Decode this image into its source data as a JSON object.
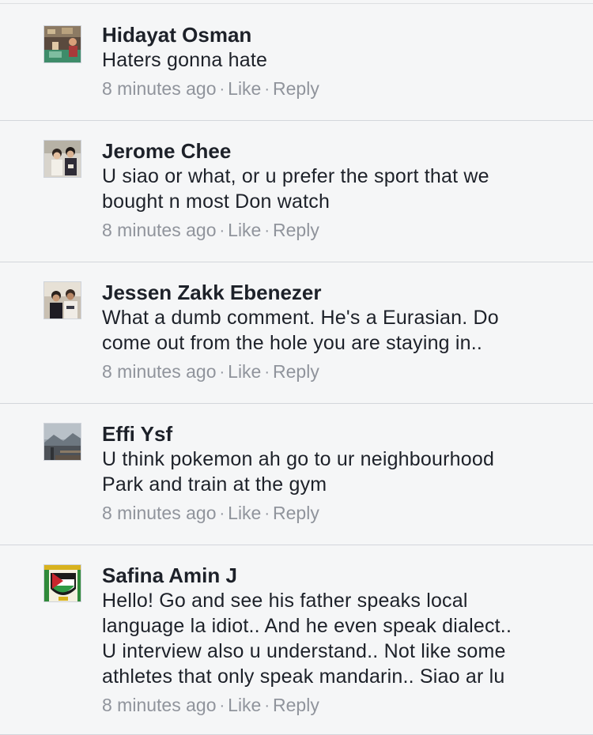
{
  "comments": [
    {
      "author": "Hidayat Osman",
      "lines": [
        "Haters gonna hate"
      ],
      "time": "8 minutes ago",
      "like": "Like",
      "reply": "Reply",
      "separator": "·",
      "avatar": "avatar-photo"
    },
    {
      "author": "Jerome Chee",
      "lines": [
        "U siao or what, or u prefer the sport that we",
        "bought n most Don watch"
      ],
      "time": "8 minutes ago",
      "like": "Like",
      "reply": "Reply",
      "separator": "·",
      "avatar": "avatar-photo"
    },
    {
      "author": "Jessen Zakk Ebenezer",
      "lines": [
        "What a dumb comment. He's a Eurasian.  Do",
        "come out from the hole you are staying in.."
      ],
      "time": "8 minutes ago",
      "like": "Like",
      "reply": "Reply",
      "separator": "·",
      "avatar": "avatar-photo"
    },
    {
      "author": "Effi Ysf",
      "lines": [
        "U think pokemon ah go to ur neighbourhood",
        "Park and train at the gym"
      ],
      "time": "8 minutes ago",
      "like": "Like",
      "reply": "Reply",
      "separator": "·",
      "avatar": "avatar-photo"
    },
    {
      "author": "Safina Amin J",
      "lines": [
        "Hello! Go and see his father speaks local",
        "language la idiot.. And he even speak dialect..",
        "U interview also u understand..  Not like some",
        "athletes that only speak mandarin.. Siao ar lu"
      ],
      "time": "8 minutes ago",
      "like": "Like",
      "reply": "Reply",
      "separator": "·",
      "avatar": "avatar-flag-emblem"
    }
  ],
  "colors": {
    "background": "#f5f6f7",
    "author": "#1d2129",
    "meta": "#90949c",
    "divider": "#d3d6db"
  }
}
